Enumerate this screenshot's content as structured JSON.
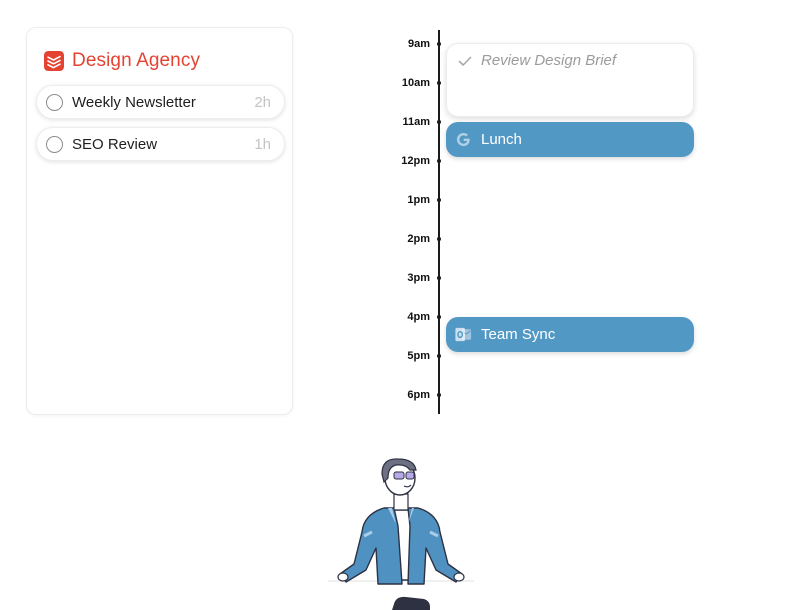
{
  "project": {
    "title": "Design Agency",
    "brand_color": "#e44332",
    "icon": "todoist-logo-icon",
    "tasks": [
      {
        "label": "Weekly Newsletter",
        "duration": "2h"
      },
      {
        "label": "SEO Review",
        "duration": "1h"
      }
    ]
  },
  "timeline": {
    "hours": [
      "9am",
      "10am",
      "11am",
      "12pm",
      "1pm",
      "2pm",
      "3pm",
      "4pm",
      "5pm",
      "6pm"
    ]
  },
  "events": {
    "review": {
      "label": "Review Design Brief",
      "status": "completed",
      "icon": "checkmark-icon"
    },
    "lunch": {
      "label": "Lunch",
      "icon": "google-calendar-icon",
      "color": "#5298c5"
    },
    "sync": {
      "label": "Team Sync",
      "icon": "outlook-icon",
      "color": "#5298c5"
    }
  },
  "illustration": {
    "icon": "person-illustration"
  }
}
